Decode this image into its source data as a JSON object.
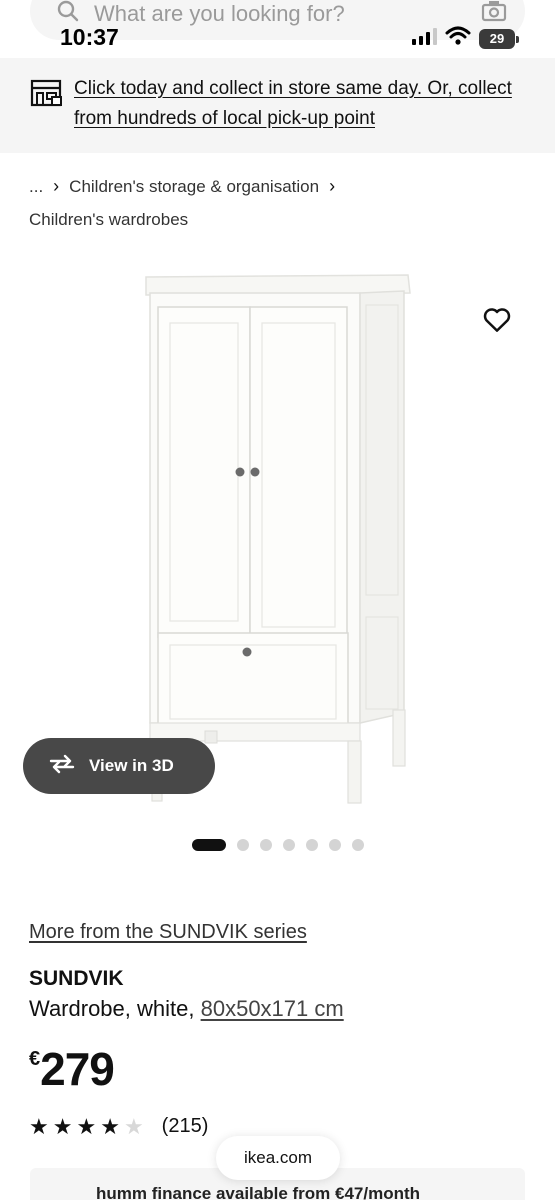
{
  "search": {
    "placeholder": "What are you looking for?"
  },
  "status_bar": {
    "time": "10:37",
    "battery": "29"
  },
  "banner": {
    "text": "Click today and collect in store same day. Or, collect from hundreds of local pick-up point"
  },
  "breadcrumb": {
    "ellipsis": "...",
    "category": "Children's storage & organisation",
    "current": "Children's wardrobes"
  },
  "gallery": {
    "view3d_label": "View in 3D",
    "image_count": 7,
    "active_index": 0
  },
  "product": {
    "series_link": "More from the SUNDVIK series",
    "name": "SUNDVIK",
    "description": "Wardrobe, white,",
    "dimensions": "80x50x171 cm",
    "currency": "€",
    "price": "279",
    "rating": 4,
    "rating_count": "(215)"
  },
  "browser": {
    "domain": "ikea.com"
  },
  "finance": {
    "text": "humm finance available from €47/month"
  },
  "icons": [
    "search-icon",
    "camera-icon",
    "signal-icon",
    "wifi-icon",
    "battery-icon",
    "store-icon",
    "chevron-right-icon",
    "heart-icon",
    "rotate-3d-icon",
    "star-icon"
  ]
}
